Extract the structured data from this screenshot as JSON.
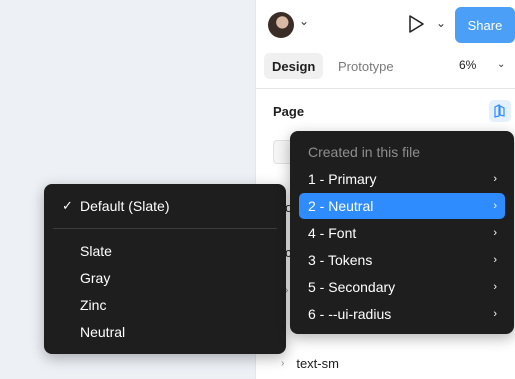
{
  "toolbar": {
    "share_label": "Share",
    "tabs": [
      "Design",
      "Prototype"
    ],
    "zoom": "6%",
    "avatar_icon": "user-avatar",
    "play_icon": "play-icon",
    "chevron_icon": "chevron-down-icon"
  },
  "panel": {
    "section_title": "Page",
    "library_icon": "library-icon",
    "fragments": [
      "o",
      "c",
      "›"
    ],
    "layer_label": "text-sm"
  },
  "mode_menu": {
    "selected": "Default (Slate)",
    "items": [
      "Slate",
      "Gray",
      "Zinc",
      "Neutral"
    ]
  },
  "collection_menu": {
    "header": "Created in this file",
    "items": [
      "1 - Primary",
      "2 - Neutral",
      "4 - Font",
      "3 - Tokens",
      "5 - Secondary",
      "6 - --ui-radius"
    ],
    "highlighted": "2 - Neutral"
  },
  "colors": {
    "accent": "#2f8cff",
    "share": "#4b9ff6",
    "menu_bg": "#1e1e1e",
    "canvas_bg": "#edf1f6"
  }
}
